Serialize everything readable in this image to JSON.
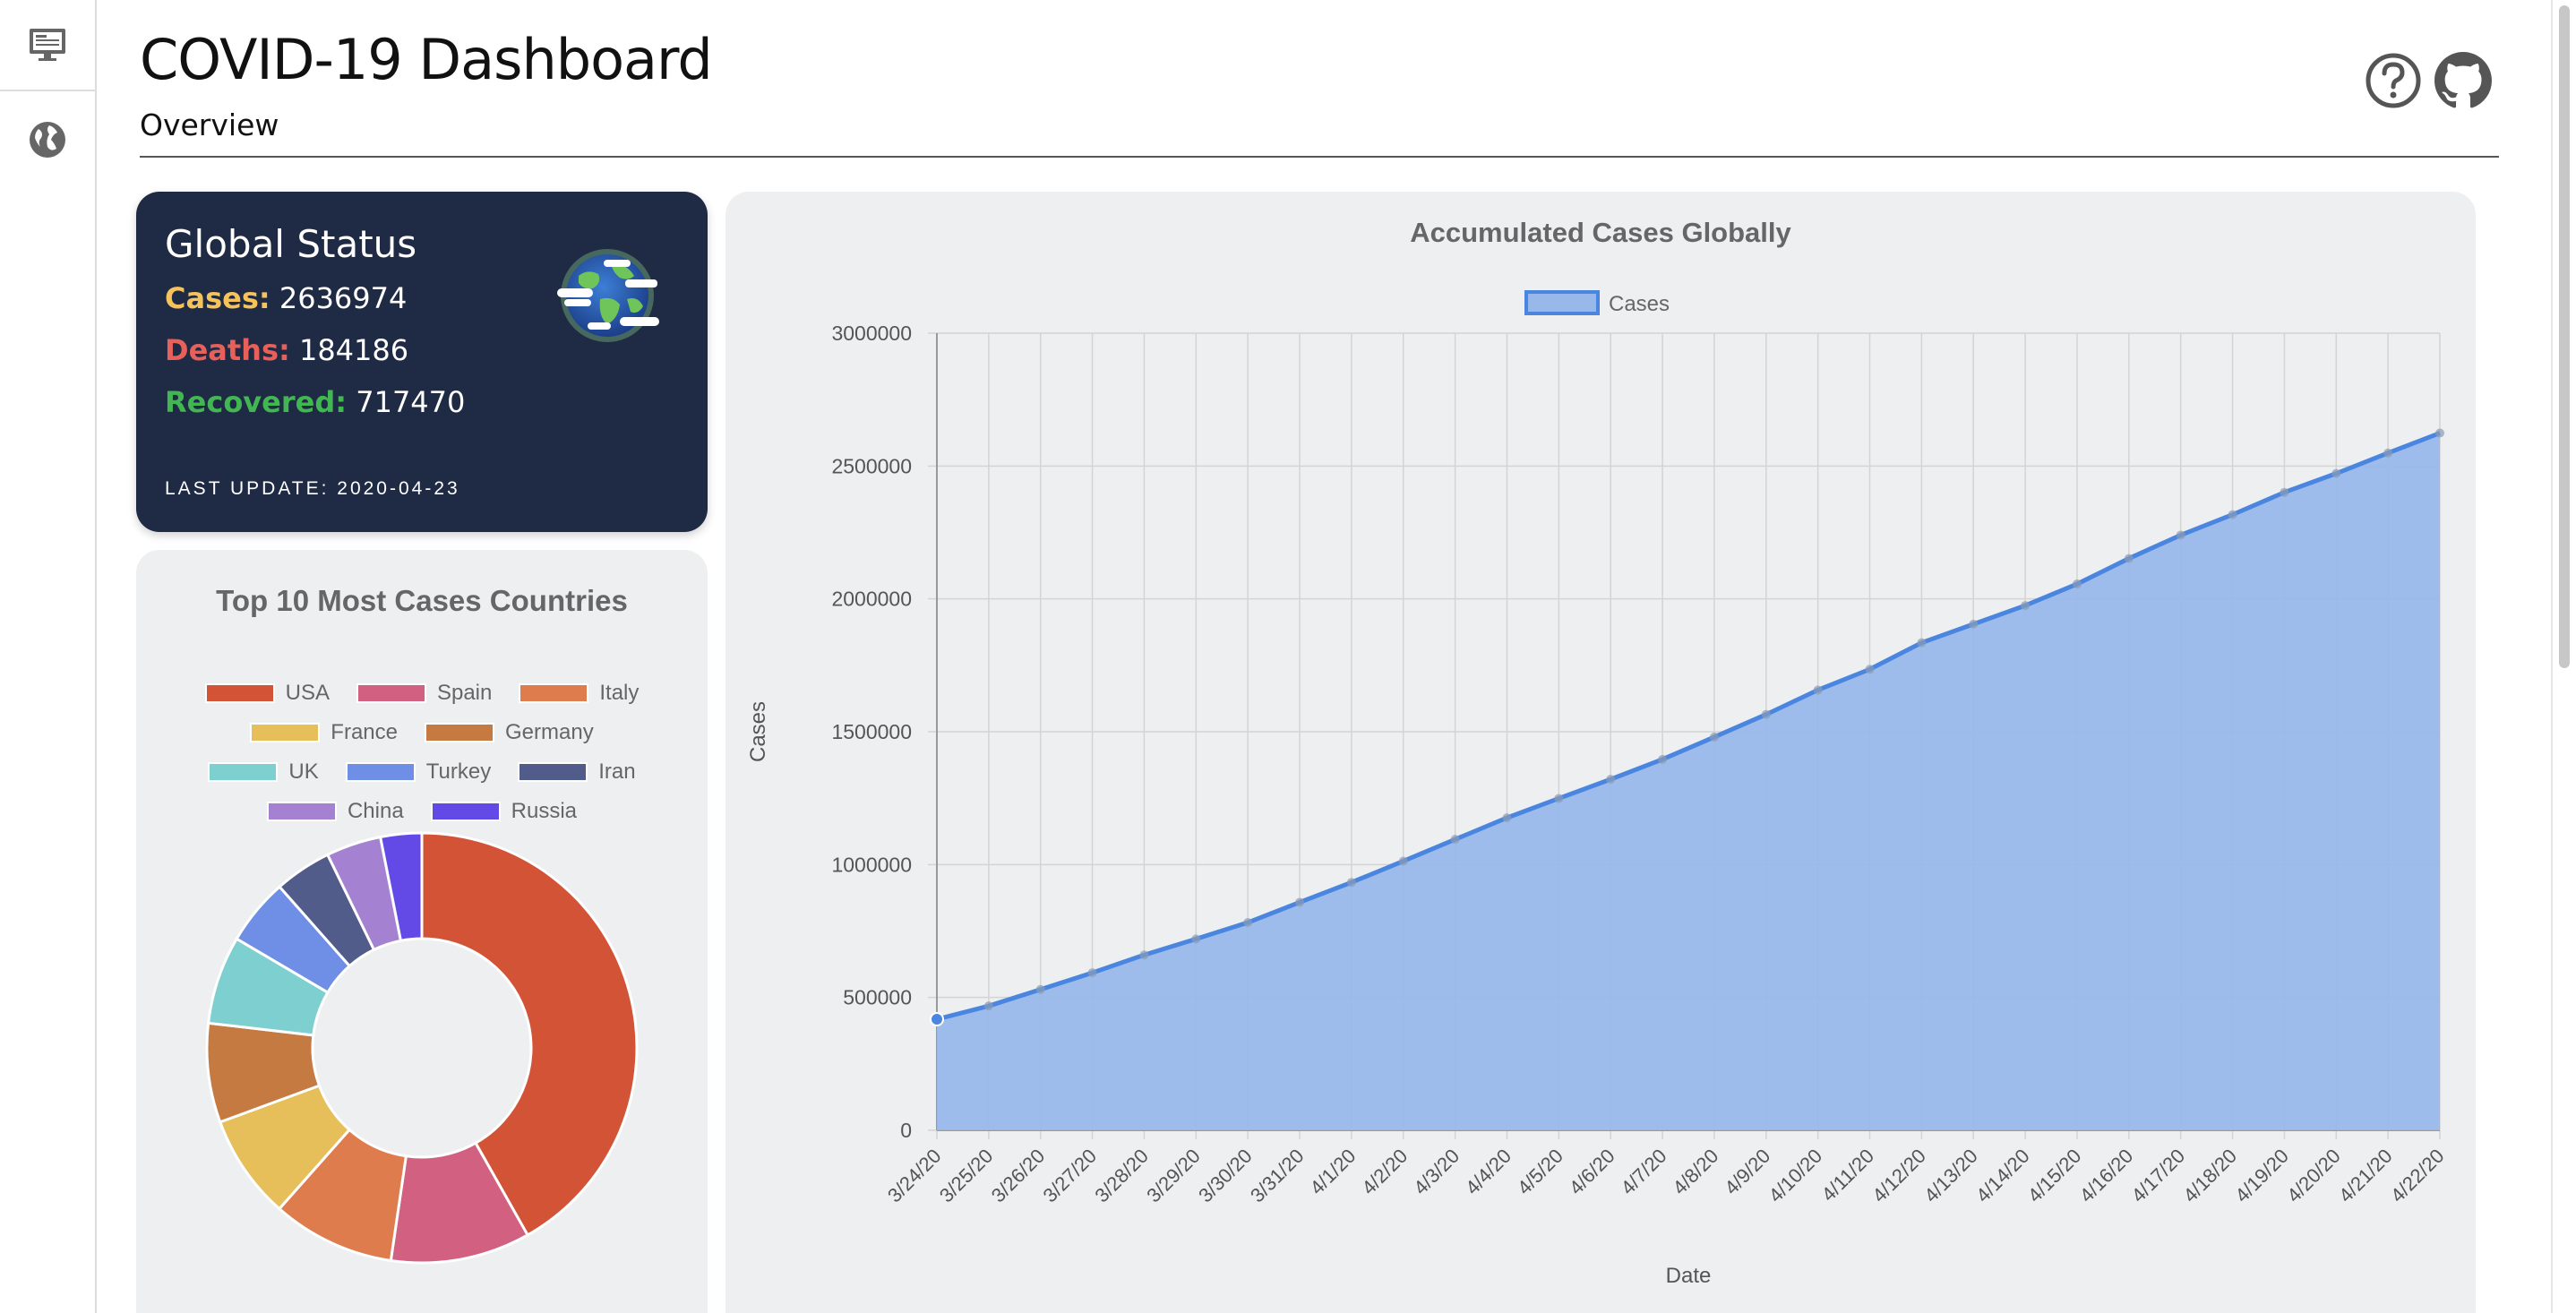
{
  "app": {
    "title": "COVID-19 Dashboard",
    "subtitle": "Overview"
  },
  "sidebar": {
    "items": [
      {
        "icon": "dashboard-monitor-icon",
        "active": true
      },
      {
        "icon": "globe-icon",
        "active": false
      }
    ]
  },
  "header_actions": [
    {
      "icon": "help-icon"
    },
    {
      "icon": "github-icon"
    }
  ],
  "global_status": {
    "title": "Global Status",
    "cases_label": "Cases:",
    "cases_value": "2636974",
    "deaths_label": "Deaths:",
    "deaths_value": "184186",
    "recovered_label": "Recovered:",
    "recovered_value": "717470",
    "last_update": "LAST UPDATE: 2020-04-23",
    "colors": {
      "background": "#1f2a44",
      "cases": "#f5c35a",
      "deaths": "#e8605a",
      "recovered": "#43b654"
    }
  },
  "chart_data": [
    {
      "type": "pie",
      "title": "Top 10 Most Cases Countries",
      "categories": [
        "USA",
        "Spain",
        "Italy",
        "France",
        "Germany",
        "UK",
        "Turkey",
        "Iran",
        "China",
        "Russia"
      ],
      "values": [
        848717,
        213024,
        187327,
        159460,
        151175,
        134638,
        101790,
        87026,
        83876,
        62773
      ],
      "colors": [
        "#d35337",
        "#d16081",
        "#de7c4d",
        "#e7bf5a",
        "#c57a42",
        "#7ecfd0",
        "#6f8ee5",
        "#525c8a",
        "#a582d1",
        "#6349e6"
      ],
      "legend": "top",
      "donut": true
    },
    {
      "type": "area",
      "title": "Accumulated Cases Globally",
      "xlabel": "Date",
      "ylabel": "Cases",
      "series": [
        {
          "name": "Cases",
          "values": [
            418000,
            468000,
            530000,
            593000,
            660000,
            720000,
            782000,
            858000,
            933000,
            1013000,
            1095000,
            1176000,
            1249000,
            1321000,
            1396000,
            1480000,
            1565000,
            1657000,
            1735000,
            1835000,
            1905000,
            1975000,
            2056000,
            2152000,
            2240000,
            2317000,
            2401000,
            2472000,
            2549000,
            2624000
          ]
        }
      ],
      "x": [
        "3/24/20",
        "3/25/20",
        "3/26/20",
        "3/27/20",
        "3/28/20",
        "3/29/20",
        "3/30/20",
        "3/31/20",
        "4/1/20",
        "4/2/20",
        "4/3/20",
        "4/4/20",
        "4/5/20",
        "4/6/20",
        "4/7/20",
        "4/8/20",
        "4/9/20",
        "4/10/20",
        "4/11/20",
        "4/12/20",
        "4/13/20",
        "4/14/20",
        "4/15/20",
        "4/16/20",
        "4/17/20",
        "4/18/20",
        "4/19/20",
        "4/20/20",
        "4/21/20",
        "4/22/20"
      ],
      "ylim": [
        0,
        3000000
      ],
      "yticks": [
        "0",
        "500000",
        "1000000",
        "1500000",
        "2000000",
        "2500000",
        "3000000"
      ],
      "colors": {
        "line": "#4a86e0",
        "fill": "#98b8ea"
      },
      "legend": "top",
      "grid": true
    }
  ]
}
